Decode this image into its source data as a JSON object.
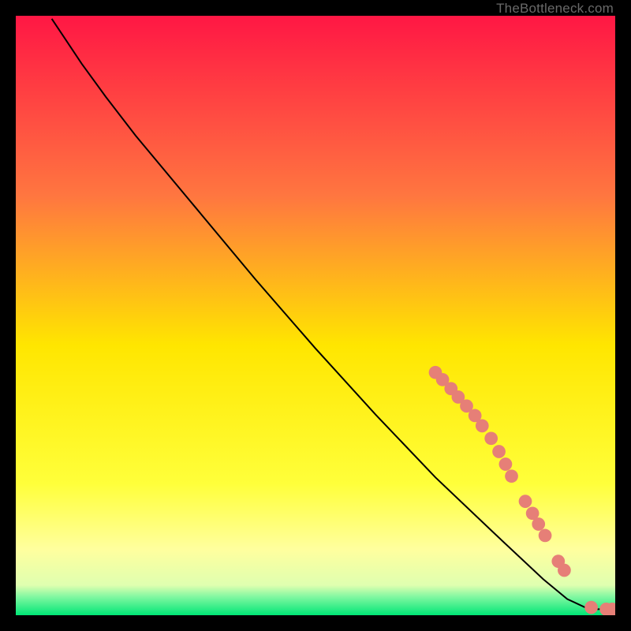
{
  "watermark": "TheBottleneck.com",
  "chart_data": {
    "type": "line",
    "title": "",
    "xlabel": "",
    "ylabel": "",
    "xlim": [
      0,
      100
    ],
    "ylim": [
      0,
      100
    ],
    "curve": [
      {
        "x": 6.0,
        "y": 99.5
      },
      {
        "x": 8.0,
        "y": 96.5
      },
      {
        "x": 11.0,
        "y": 92.0
      },
      {
        "x": 15.0,
        "y": 86.5
      },
      {
        "x": 20.0,
        "y": 80.0
      },
      {
        "x": 30.0,
        "y": 68.0
      },
      {
        "x": 40.0,
        "y": 56.0
      },
      {
        "x": 50.0,
        "y": 44.5
      },
      {
        "x": 60.0,
        "y": 33.5
      },
      {
        "x": 70.0,
        "y": 23.0
      },
      {
        "x": 80.0,
        "y": 13.5
      },
      {
        "x": 88.0,
        "y": 6.0
      },
      {
        "x": 92.0,
        "y": 2.7
      },
      {
        "x": 95.0,
        "y": 1.3
      },
      {
        "x": 97.0,
        "y": 1.0
      },
      {
        "x": 99.0,
        "y": 1.0
      }
    ],
    "markers": [
      {
        "x": 70.0,
        "y": 40.5,
        "r": 1.1
      },
      {
        "x": 71.2,
        "y": 39.3,
        "r": 1.1
      },
      {
        "x": 72.6,
        "y": 37.8,
        "r": 1.1
      },
      {
        "x": 73.8,
        "y": 36.4,
        "r": 1.1
      },
      {
        "x": 75.2,
        "y": 34.9,
        "r": 1.1
      },
      {
        "x": 76.6,
        "y": 33.3,
        "r": 1.1
      },
      {
        "x": 77.8,
        "y": 31.6,
        "r": 1.1
      },
      {
        "x": 79.3,
        "y": 29.5,
        "r": 1.1
      },
      {
        "x": 80.6,
        "y": 27.3,
        "r": 1.1
      },
      {
        "x": 81.7,
        "y": 25.2,
        "r": 1.1
      },
      {
        "x": 82.7,
        "y": 23.2,
        "r": 1.1
      },
      {
        "x": 85.0,
        "y": 19.0,
        "r": 1.1
      },
      {
        "x": 86.2,
        "y": 17.0,
        "r": 1.1
      },
      {
        "x": 87.2,
        "y": 15.2,
        "r": 1.1
      },
      {
        "x": 88.3,
        "y": 13.3,
        "r": 1.1
      },
      {
        "x": 90.5,
        "y": 9.0,
        "r": 1.1
      },
      {
        "x": 91.5,
        "y": 7.5,
        "r": 1.1
      },
      {
        "x": 96.0,
        "y": 1.3,
        "r": 1.1
      },
      {
        "x": 98.5,
        "y": 1.0,
        "r": 1.1
      },
      {
        "x": 99.5,
        "y": 1.0,
        "r": 1.1
      }
    ],
    "marker_color": "#e67f77",
    "line_color": "#000000",
    "gradient_top": "#ff1744",
    "gradient_mid1": "#ff7a3c",
    "gradient_mid2": "#ffe600",
    "gradient_band": "#ffff9e",
    "gradient_bottom": "#00e676"
  }
}
